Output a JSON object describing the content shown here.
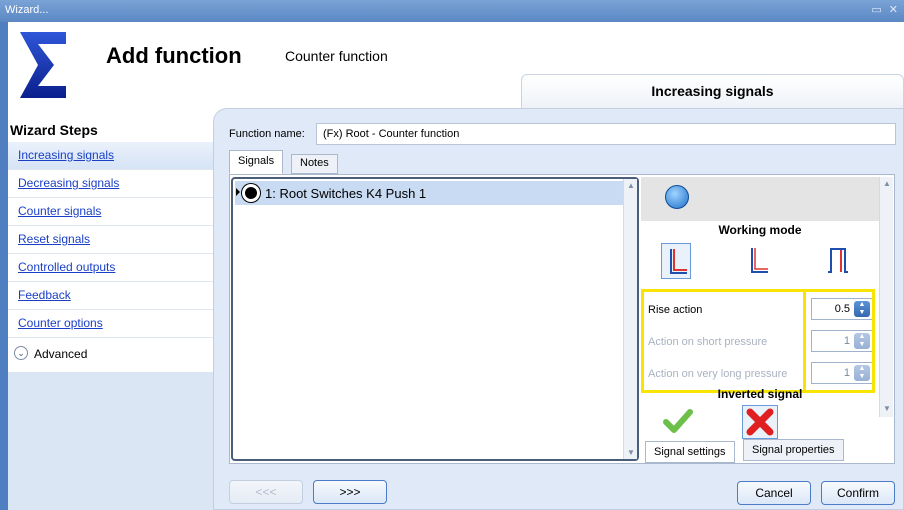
{
  "window": {
    "title": "Wizard...",
    "controls": "▭ ✕"
  },
  "header": {
    "title": "Add function",
    "subtitle": "Counter function",
    "step_tab": "Increasing signals"
  },
  "sidebar": {
    "title": "Wizard Steps",
    "items": [
      {
        "label": "Increasing signals",
        "active": true
      },
      {
        "label": "Decreasing signals"
      },
      {
        "label": "Counter signals"
      },
      {
        "label": "Reset signals"
      },
      {
        "label": "Controlled outputs"
      },
      {
        "label": "Feedback"
      },
      {
        "label": "Counter options"
      }
    ],
    "advanced_label": "Advanced"
  },
  "form": {
    "function_name_label": "Function name:",
    "function_name_value": "(Fx) Root - Counter function"
  },
  "tabs": [
    {
      "label": "Signals",
      "selected": true
    },
    {
      "label": "Notes"
    }
  ],
  "signal_list": [
    {
      "label": "1: Root Switches K4 Push 1"
    }
  ],
  "properties": {
    "working_mode_label": "Working mode",
    "rows": [
      {
        "label": "Rise action",
        "value": "0.5",
        "enabled": true
      },
      {
        "label": "Action on short pressure",
        "value": "1",
        "enabled": false
      },
      {
        "label": "Action on very long pressure",
        "value": "1",
        "enabled": false
      }
    ],
    "inverted_signal_label": "Inverted signal",
    "tabs": [
      {
        "label": "Signal settings"
      },
      {
        "label": "Signal properties",
        "selected": true
      }
    ]
  },
  "footer": {
    "prev_label": "<<<",
    "next_label": ">>>",
    "cancel_label": "Cancel",
    "confirm_label": "Confirm"
  },
  "colors": {
    "accent": "#4b7cc5",
    "highlight": "#f7e400",
    "titlebar": "#5b88c4"
  }
}
